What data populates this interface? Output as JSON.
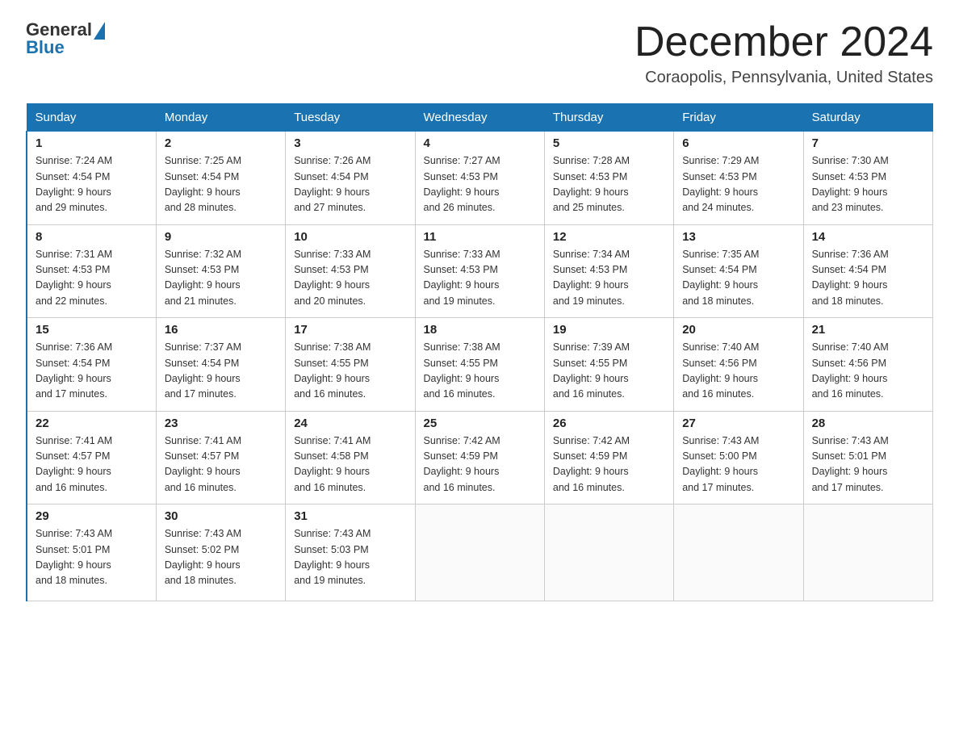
{
  "logo": {
    "general": "General",
    "blue": "Blue"
  },
  "title": "December 2024",
  "location": "Coraopolis, Pennsylvania, United States",
  "days_of_week": [
    "Sunday",
    "Monday",
    "Tuesday",
    "Wednesday",
    "Thursday",
    "Friday",
    "Saturday"
  ],
  "weeks": [
    [
      {
        "day": "1",
        "sunrise": "7:24 AM",
        "sunset": "4:54 PM",
        "daylight": "9 hours and 29 minutes."
      },
      {
        "day": "2",
        "sunrise": "7:25 AM",
        "sunset": "4:54 PM",
        "daylight": "9 hours and 28 minutes."
      },
      {
        "day": "3",
        "sunrise": "7:26 AM",
        "sunset": "4:54 PM",
        "daylight": "9 hours and 27 minutes."
      },
      {
        "day": "4",
        "sunrise": "7:27 AM",
        "sunset": "4:53 PM",
        "daylight": "9 hours and 26 minutes."
      },
      {
        "day": "5",
        "sunrise": "7:28 AM",
        "sunset": "4:53 PM",
        "daylight": "9 hours and 25 minutes."
      },
      {
        "day": "6",
        "sunrise": "7:29 AM",
        "sunset": "4:53 PM",
        "daylight": "9 hours and 24 minutes."
      },
      {
        "day": "7",
        "sunrise": "7:30 AM",
        "sunset": "4:53 PM",
        "daylight": "9 hours and 23 minutes."
      }
    ],
    [
      {
        "day": "8",
        "sunrise": "7:31 AM",
        "sunset": "4:53 PM",
        "daylight": "9 hours and 22 minutes."
      },
      {
        "day": "9",
        "sunrise": "7:32 AM",
        "sunset": "4:53 PM",
        "daylight": "9 hours and 21 minutes."
      },
      {
        "day": "10",
        "sunrise": "7:33 AM",
        "sunset": "4:53 PM",
        "daylight": "9 hours and 20 minutes."
      },
      {
        "day": "11",
        "sunrise": "7:33 AM",
        "sunset": "4:53 PM",
        "daylight": "9 hours and 19 minutes."
      },
      {
        "day": "12",
        "sunrise": "7:34 AM",
        "sunset": "4:53 PM",
        "daylight": "9 hours and 19 minutes."
      },
      {
        "day": "13",
        "sunrise": "7:35 AM",
        "sunset": "4:54 PM",
        "daylight": "9 hours and 18 minutes."
      },
      {
        "day": "14",
        "sunrise": "7:36 AM",
        "sunset": "4:54 PM",
        "daylight": "9 hours and 18 minutes."
      }
    ],
    [
      {
        "day": "15",
        "sunrise": "7:36 AM",
        "sunset": "4:54 PM",
        "daylight": "9 hours and 17 minutes."
      },
      {
        "day": "16",
        "sunrise": "7:37 AM",
        "sunset": "4:54 PM",
        "daylight": "9 hours and 17 minutes."
      },
      {
        "day": "17",
        "sunrise": "7:38 AM",
        "sunset": "4:55 PM",
        "daylight": "9 hours and 16 minutes."
      },
      {
        "day": "18",
        "sunrise": "7:38 AM",
        "sunset": "4:55 PM",
        "daylight": "9 hours and 16 minutes."
      },
      {
        "day": "19",
        "sunrise": "7:39 AM",
        "sunset": "4:55 PM",
        "daylight": "9 hours and 16 minutes."
      },
      {
        "day": "20",
        "sunrise": "7:40 AM",
        "sunset": "4:56 PM",
        "daylight": "9 hours and 16 minutes."
      },
      {
        "day": "21",
        "sunrise": "7:40 AM",
        "sunset": "4:56 PM",
        "daylight": "9 hours and 16 minutes."
      }
    ],
    [
      {
        "day": "22",
        "sunrise": "7:41 AM",
        "sunset": "4:57 PM",
        "daylight": "9 hours and 16 minutes."
      },
      {
        "day": "23",
        "sunrise": "7:41 AM",
        "sunset": "4:57 PM",
        "daylight": "9 hours and 16 minutes."
      },
      {
        "day": "24",
        "sunrise": "7:41 AM",
        "sunset": "4:58 PM",
        "daylight": "9 hours and 16 minutes."
      },
      {
        "day": "25",
        "sunrise": "7:42 AM",
        "sunset": "4:59 PM",
        "daylight": "9 hours and 16 minutes."
      },
      {
        "day": "26",
        "sunrise": "7:42 AM",
        "sunset": "4:59 PM",
        "daylight": "9 hours and 16 minutes."
      },
      {
        "day": "27",
        "sunrise": "7:43 AM",
        "sunset": "5:00 PM",
        "daylight": "9 hours and 17 minutes."
      },
      {
        "day": "28",
        "sunrise": "7:43 AM",
        "sunset": "5:01 PM",
        "daylight": "9 hours and 17 minutes."
      }
    ],
    [
      {
        "day": "29",
        "sunrise": "7:43 AM",
        "sunset": "5:01 PM",
        "daylight": "9 hours and 18 minutes."
      },
      {
        "day": "30",
        "sunrise": "7:43 AM",
        "sunset": "5:02 PM",
        "daylight": "9 hours and 18 minutes."
      },
      {
        "day": "31",
        "sunrise": "7:43 AM",
        "sunset": "5:03 PM",
        "daylight": "9 hours and 19 minutes."
      },
      null,
      null,
      null,
      null
    ]
  ],
  "labels": {
    "sunrise": "Sunrise:",
    "sunset": "Sunset:",
    "daylight": "Daylight:"
  }
}
